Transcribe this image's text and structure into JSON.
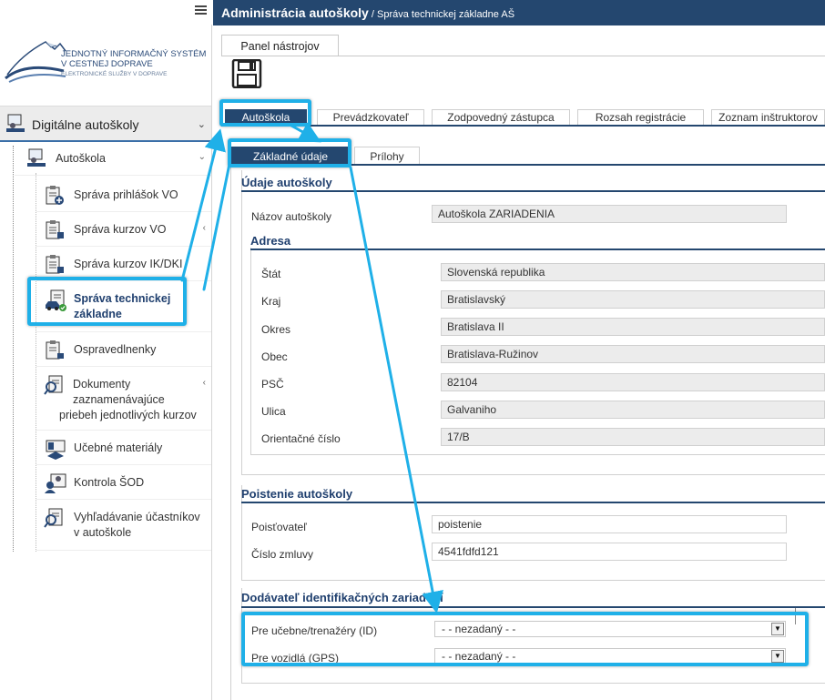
{
  "logo": {
    "line1": "JEDNOTNÝ INFORMAČNÝ SYSTÉM",
    "line2": "V CESTNEJ DOPRAVE",
    "line3": "ELEKTRONICKÉ SLUŽBY V DOPRAVE"
  },
  "sidebar": {
    "head_label": "Digitálne autoškoly",
    "sub_label": "Autoškola",
    "items": [
      {
        "label": "Správa prihlášok VO"
      },
      {
        "label": "Správa kurzov VO"
      },
      {
        "label": "Správa kurzov IK/DKI"
      },
      {
        "label_line1": "Správa technickej",
        "label_line2": "základne"
      },
      {
        "label": "Ospravedlnenky"
      },
      {
        "label_line1": "Dokumenty",
        "label_line2": "zaznamenávajúce",
        "label_line3": "priebeh jednotlivých kurzov"
      },
      {
        "label": "Učebné materiály"
      },
      {
        "label": "Kontrola ŠOD"
      },
      {
        "label_line1": "Vyhľadávanie účastníkov",
        "label_line2": "v autoškole"
      }
    ]
  },
  "header": {
    "title": "Administrácia autoškoly",
    "subtitle": " / Správa technickej základne AŠ"
  },
  "toolbar": {
    "panel_label": "Panel nástrojov"
  },
  "tabs": [
    "Autoškola",
    "Prevádzkovateľ",
    "Zodpovedný zástupca",
    "Rozsah registrácie",
    "Zoznam inštruktorov"
  ],
  "subtabs": [
    "Základné údaje",
    "Prílohy"
  ],
  "school": {
    "section_title": "Údaje autoškoly",
    "name_label": "Názov autoškoly",
    "name_value": "Autoškola ZARIADENIA"
  },
  "address": {
    "title": "Adresa",
    "rows": [
      {
        "label": "Štát",
        "value": "Slovenská republika"
      },
      {
        "label": "Kraj",
        "value": "Bratislavský"
      },
      {
        "label": "Okres",
        "value": "Bratislava II"
      },
      {
        "label": "Obec",
        "value": "Bratislava-Ružinov"
      },
      {
        "label": "PSČ",
        "value": "82104"
      },
      {
        "label": "Ulica",
        "value": "Galvaniho"
      },
      {
        "label": "Orientačné číslo",
        "value": "17/B"
      }
    ]
  },
  "insurance": {
    "title": "Poistenie autoškoly",
    "insurer_label": "Poisťovateľ",
    "insurer_value": "poistenie",
    "contract_label": "Číslo zmluvy",
    "contract_value": "4541fdfd121"
  },
  "supplier": {
    "title": "Dodávateľ identifikačných zariadení",
    "rows": [
      {
        "label": "Pre učebne/trenažéry (ID)",
        "value": "- - nezadaný - -"
      },
      {
        "label": "Pre vozidlá (GPS)",
        "value": "- - nezadaný - -"
      }
    ]
  },
  "colors": {
    "header": "#24476f",
    "highlight": "#1fb0e8"
  }
}
